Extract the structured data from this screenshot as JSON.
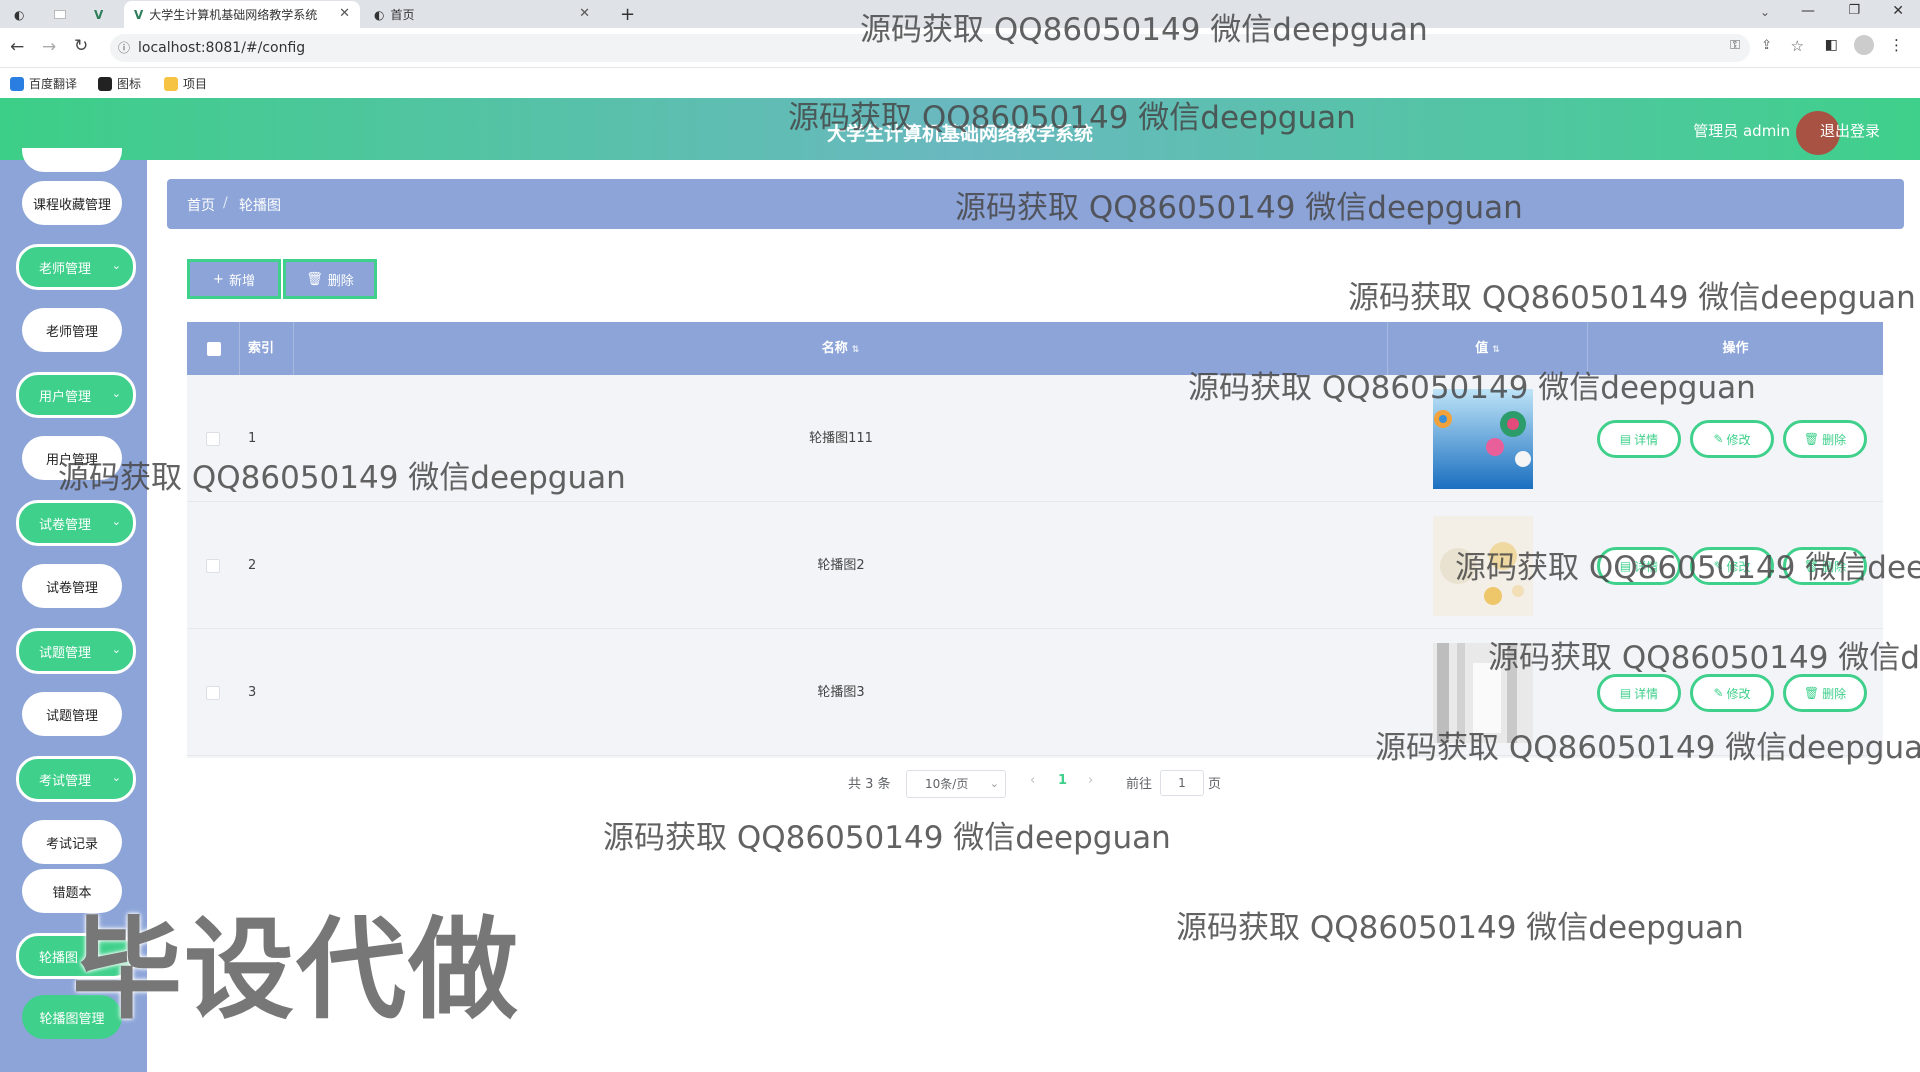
{
  "browser": {
    "tabs": [
      {
        "title": "大学生计算机基础网络教学系统",
        "active": true
      },
      {
        "title": "首页",
        "active": false
      }
    ],
    "new_tab_label": "+",
    "url": "localhost:8081/#/config",
    "bookmarks": [
      "百度翻译",
      "图标",
      "项目"
    ]
  },
  "header": {
    "system_title": "大学生计算机基础网络教学系统",
    "admin_label": "管理员 admin",
    "logout_label": "退出登录"
  },
  "sidebar": {
    "items": [
      {
        "label": "课程收藏管理",
        "kind": "child"
      },
      {
        "label": "老师管理",
        "kind": "parent"
      },
      {
        "label": "老师管理",
        "kind": "child"
      },
      {
        "label": "用户管理",
        "kind": "parent"
      },
      {
        "label": "用户管理",
        "kind": "child"
      },
      {
        "label": "试卷管理",
        "kind": "parent"
      },
      {
        "label": "试卷管理",
        "kind": "child"
      },
      {
        "label": "试题管理",
        "kind": "parent"
      },
      {
        "label": "试题管理",
        "kind": "child"
      },
      {
        "label": "考试管理",
        "kind": "parent"
      },
      {
        "label": "考试记录",
        "kind": "child"
      },
      {
        "label": "错题本",
        "kind": "child"
      },
      {
        "label": "轮播图",
        "kind": "parent"
      },
      {
        "label": "轮播图管理",
        "kind": "child-active"
      }
    ]
  },
  "breadcrumb": {
    "home": "首页",
    "separator": "/",
    "current": "轮播图"
  },
  "toolbar": {
    "add_label": "新增",
    "delete_label": "删除"
  },
  "table": {
    "columns": {
      "index": "索引",
      "name": "名称",
      "value": "值",
      "actions": "操作"
    },
    "rows": [
      {
        "index": "1",
        "name": "轮播图111"
      },
      {
        "index": "2",
        "name": "轮播图2"
      },
      {
        "index": "3",
        "name": "轮播图3"
      }
    ],
    "actions": {
      "detail": "详情",
      "edit": "修改",
      "delete": "删除"
    }
  },
  "pagination": {
    "total_text": "共 3 条",
    "page_size": "10条/页",
    "current_page": "1",
    "goto_prefix": "前往",
    "goto_value": "1",
    "goto_suffix": "页"
  },
  "watermarks": {
    "text": "源码获取 QQ86050149 微信deepguan",
    "big": "毕设代做"
  },
  "colors": {
    "accent_green": "#3fd08b",
    "panel_blue": "#8ca4d8"
  }
}
